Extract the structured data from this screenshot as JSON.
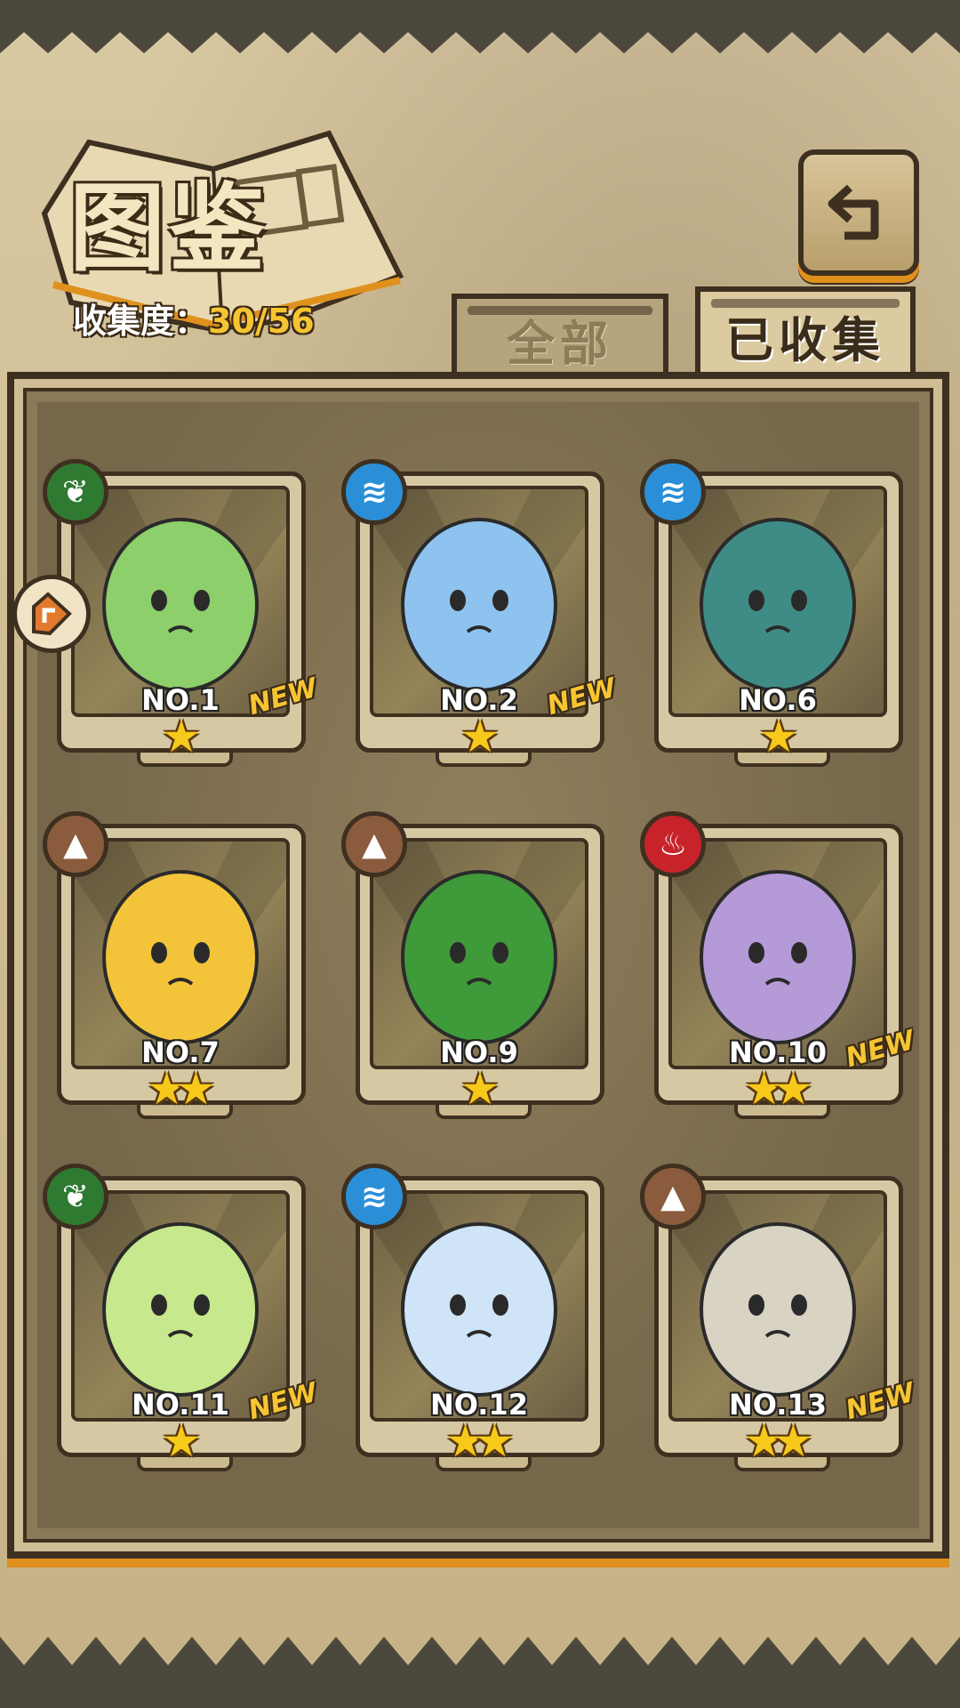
{
  "header": {
    "title": "图鉴",
    "progress_label": "收集度：",
    "progress_value": "30/56"
  },
  "tabs": [
    {
      "label": "全部",
      "active": false
    },
    {
      "label": "已收集",
      "active": true
    }
  ],
  "icons": {
    "back": "return-arrow-icon",
    "side_tag": "tag-arrow-icon"
  },
  "colors": {
    "accent": "#f6c531",
    "frame": "#3e3020",
    "leaf": "#2f7a31",
    "water": "#2a8fd6",
    "earth": "#8a5b3c",
    "fire": "#c8232a"
  },
  "cards": [
    {
      "no": "NO.1",
      "element": "leaf",
      "stars": 1,
      "new": true,
      "new_label": "NEW",
      "color": "#8dcf6b"
    },
    {
      "no": "NO.2",
      "element": "water",
      "stars": 1,
      "new": true,
      "new_label": "NEW",
      "color": "#8fc3ef"
    },
    {
      "no": "NO.6",
      "element": "water",
      "stars": 1,
      "new": false,
      "new_label": "",
      "color": "#3f8c86"
    },
    {
      "no": "NO.7",
      "element": "earth",
      "stars": 2,
      "new": false,
      "new_label": "",
      "color": "#f3c43a"
    },
    {
      "no": "NO.9",
      "element": "earth",
      "stars": 1,
      "new": false,
      "new_label": "",
      "color": "#3f9a3a"
    },
    {
      "no": "NO.10",
      "element": "fire",
      "stars": 2,
      "new": true,
      "new_label": "NEW",
      "color": "#b59ad8"
    },
    {
      "no": "NO.11",
      "element": "leaf",
      "stars": 1,
      "new": true,
      "new_label": "NEW",
      "color": "#c7e88c"
    },
    {
      "no": "NO.12",
      "element": "water",
      "stars": 2,
      "new": false,
      "new_label": "",
      "color": "#cfe4f6"
    },
    {
      "no": "NO.13",
      "element": "earth",
      "stars": 2,
      "new": true,
      "new_label": "NEW",
      "color": "#d9d3c4"
    }
  ]
}
